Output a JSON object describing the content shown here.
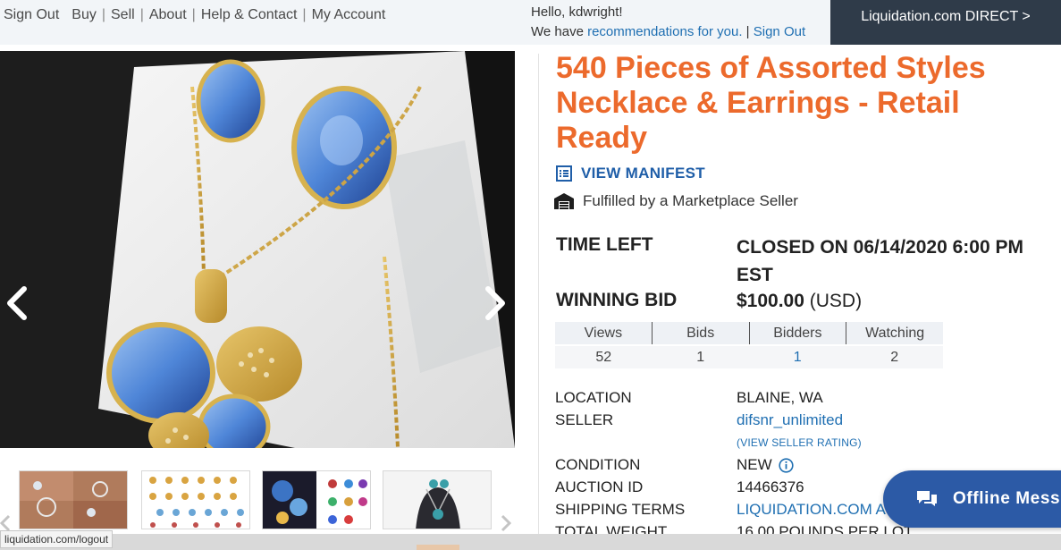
{
  "colors": {
    "title": "#ec6a2c",
    "link": "#1f6fb2",
    "direct_bg": "#2f3b49",
    "chat_bg": "#2c5aa6"
  },
  "topnav": {
    "items": [
      "Sign Out",
      "Buy",
      "Sell",
      "About",
      "Help & Contact",
      "My Account"
    ]
  },
  "greeting": {
    "hello": "Hello, kdwright!",
    "we_have": "We have ",
    "recommendations": "recommendations for you.",
    "separator": " | ",
    "sign_out": "Sign Out"
  },
  "direct_button": "Liquidation.com DIRECT >",
  "listing": {
    "title": "540 Pieces of Assorted Styles Necklace & Earrings - Retail Ready",
    "view_manifest": "VIEW MANIFEST",
    "fulfilled": "Fulfilled by a Marketplace Seller",
    "time_left_label": "TIME LEFT",
    "time_left_value": "CLOSED ON 06/14/2020 6:00 PM EST",
    "winning_bid_label": "WINNING BID",
    "winning_bid_amount": "$100.00",
    "winning_bid_currency": "(USD)"
  },
  "stats": {
    "headers": [
      "Views",
      "Bids",
      "Bidders",
      "Watching"
    ],
    "values": [
      "52",
      "1",
      "1",
      "2"
    ]
  },
  "details": {
    "location_label": "LOCATION",
    "location_value": "BLAINE, WA",
    "seller_label": "SELLER",
    "seller_value": "difsnr_unlimited",
    "seller_rating": "(VIEW SELLER RATING)",
    "condition_label": "CONDITION",
    "condition_value": "NEW",
    "auction_id_label": "AUCTION ID",
    "auction_id_value": "14466376",
    "shipping_label": "SHIPPING TERMS",
    "shipping_value": "LIQUIDATION.COM A",
    "weight_label": "TOTAL WEIGHT",
    "weight_value": "16.00 POUNDS PER LOT"
  },
  "chat": {
    "label": "Offline Mess"
  },
  "status_bar": {
    "url": "liquidation.com/logout"
  },
  "icons": [
    "chevron-left-icon",
    "chevron-right-icon",
    "manifest-list-icon",
    "warehouse-icon",
    "info-circle-icon",
    "chat-bubbles-icon"
  ]
}
